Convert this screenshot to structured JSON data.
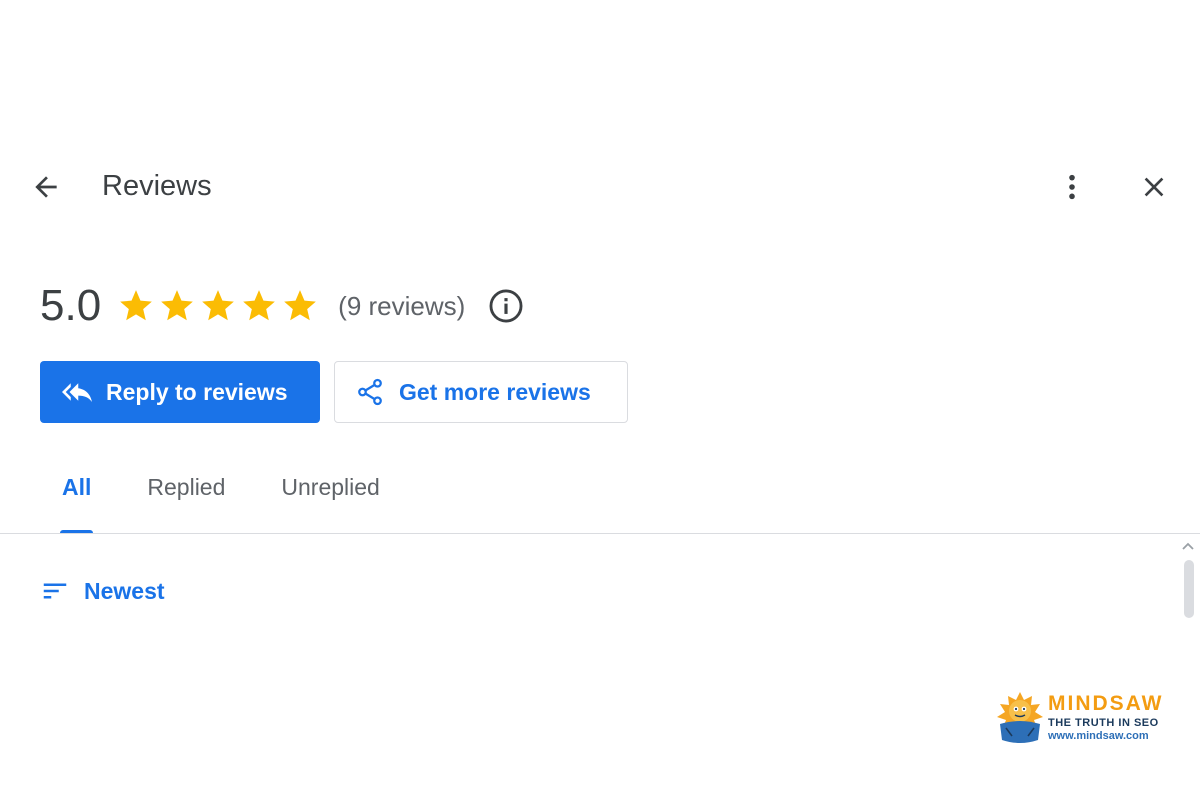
{
  "header": {
    "title": "Reviews",
    "back_icon": "arrow-left-icon",
    "more_icon": "more-vert-icon",
    "close_icon": "close-icon"
  },
  "rating": {
    "score": "5.0",
    "stars": 5,
    "stars_max": 5,
    "count_text": "(9 reviews)",
    "info_icon": "info-icon"
  },
  "actions": {
    "reply_label": "Reply to reviews",
    "get_more_label": "Get more reviews"
  },
  "tabs": [
    {
      "label": "All",
      "active": true
    },
    {
      "label": "Replied",
      "active": false
    },
    {
      "label": "Unreplied",
      "active": false
    }
  ],
  "sort": {
    "label": "Newest",
    "icon": "sort-icon"
  },
  "watermark": {
    "name": "MINDSAW",
    "tagline": "THE TRUTH IN SEO",
    "url": "www.mindsaw.com"
  },
  "colors": {
    "accent": "#1a73e8",
    "star": "#fbbc04",
    "text": "#3c4043",
    "muted": "#5f6368",
    "divider": "#dadce0"
  }
}
